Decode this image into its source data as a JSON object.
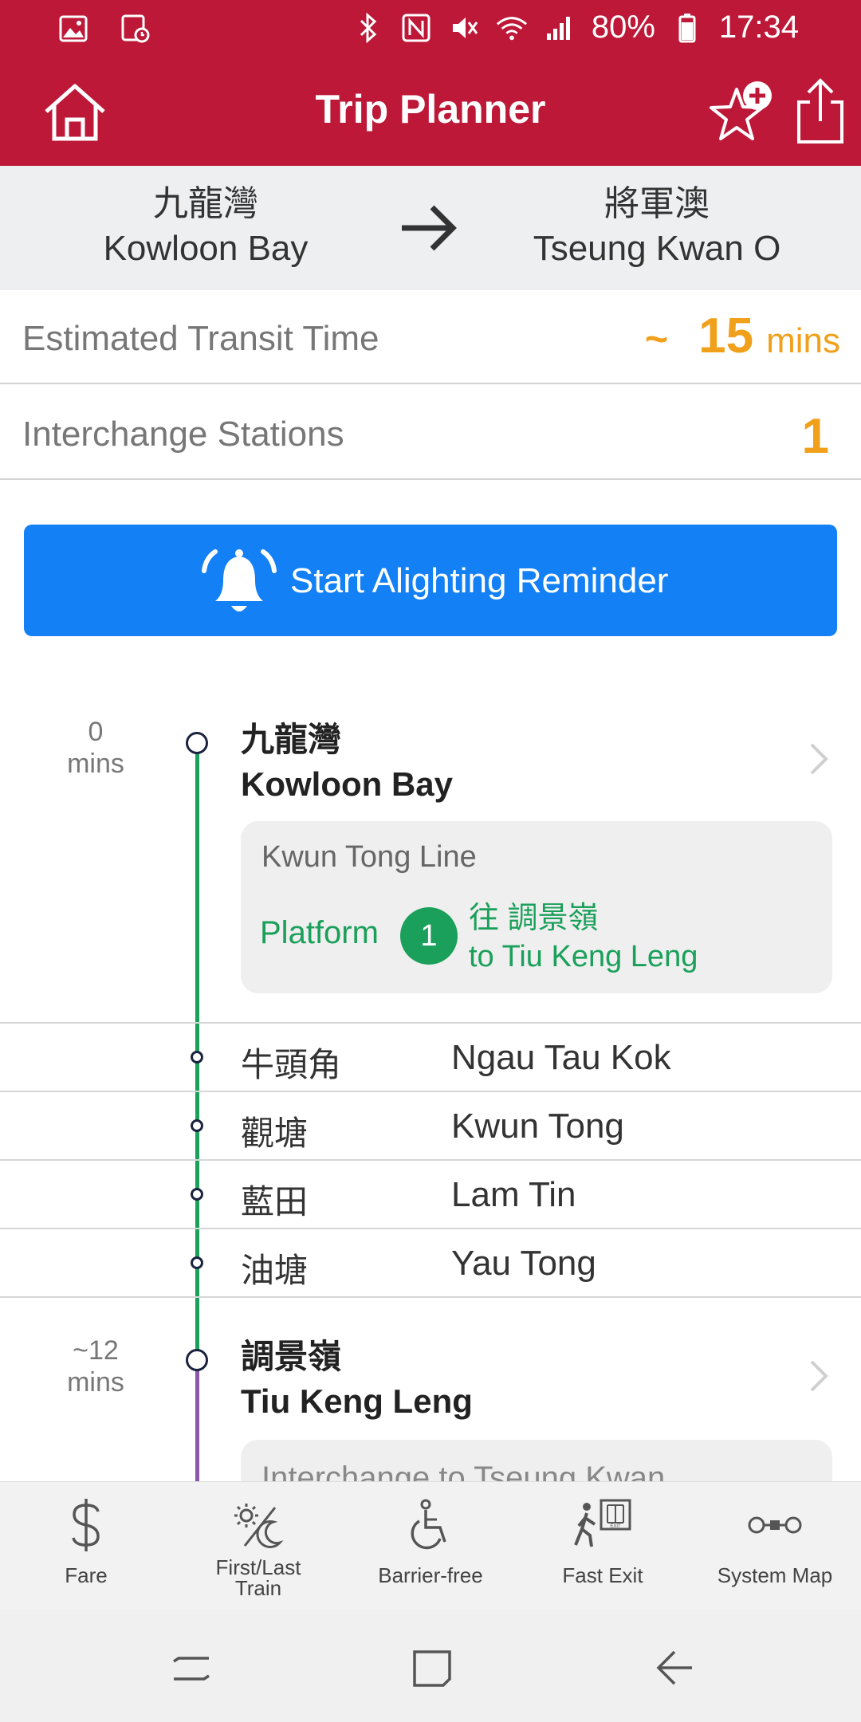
{
  "status_bar": {
    "battery": "80%",
    "time": "17:34"
  },
  "app_bar": {
    "title": "Trip Planner"
  },
  "route": {
    "from_zh": "九龍灣",
    "from_en": "Kowloon Bay",
    "to_zh": "將軍澳",
    "to_en": "Tseung Kwan O"
  },
  "summary": {
    "transit_label": "Estimated Transit Time",
    "transit_tilde": "~",
    "transit_value": "15",
    "transit_unit": "mins",
    "interchange_label": "Interchange Stations",
    "interchange_value": "1"
  },
  "reminder": {
    "label": "Start Alighting Reminder"
  },
  "journey": {
    "origin": {
      "mins_value": "0",
      "mins_unit": "mins",
      "name_zh": "九龍灣",
      "name_en": "Kowloon Bay",
      "line_name": "Kwun Tong Line",
      "platform_label": "Platform",
      "platform_number": "1",
      "towards_zh": "往 調景嶺",
      "towards_en": "to Tiu Keng Leng"
    },
    "stops": [
      {
        "zh": "牛頭角",
        "en": "Ngau Tau Kok"
      },
      {
        "zh": "觀塘",
        "en": "Kwun Tong"
      },
      {
        "zh": "藍田",
        "en": "Lam Tin"
      },
      {
        "zh": "油塘",
        "en": "Yau Tong"
      }
    ],
    "interchange": {
      "mins_value": "~12",
      "mins_unit": "mins",
      "name_zh": "調景嶺",
      "name_en": "Tiu Keng Leng",
      "card_text": "Interchange to Tseung Kwan"
    }
  },
  "toolbar": {
    "fare": "Fare",
    "first_last_line1": "First/Last",
    "first_last_line2": "Train",
    "barrier_free": "Barrier-free",
    "fast_exit": "Fast Exit",
    "system_map": "System Map"
  },
  "colors": {
    "brand_red": "#bd1838",
    "accent_blue": "#1380f6",
    "line_green": "#1aa05a",
    "line_purple": "#8a5aa8",
    "highlight_orange": "#f0a01a"
  },
  "icons": {
    "status_left": [
      "gallery-icon",
      "screenshot-icon"
    ],
    "status_right": [
      "bluetooth-icon",
      "nfc-icon",
      "mute-icon",
      "wifi-icon",
      "signal-icon",
      "battery-icon"
    ]
  }
}
